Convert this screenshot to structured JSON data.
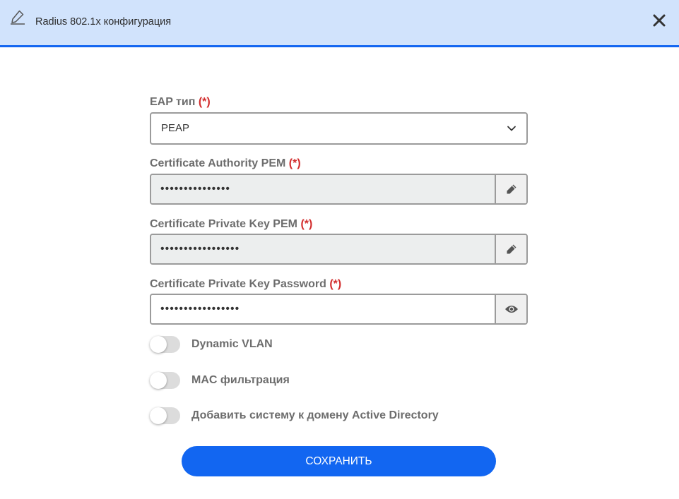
{
  "header": {
    "title": "Radius 802.1x конфигурация",
    "icon": "pencil-icon",
    "close_icon": "close-icon",
    "background": "#d1e3fc",
    "accent": "#1266f1"
  },
  "form": {
    "required_marker": "(*)",
    "eap_type": {
      "label": "EAP тип",
      "value": "PEAP"
    },
    "ca_pem": {
      "label": "Certificate Authority PEM",
      "value": "•••••••••••••••",
      "action_icon": "pencil-icon"
    },
    "private_key_pem": {
      "label": "Certificate Private Key PEM",
      "value": "•••••••••••••••••",
      "action_icon": "pencil-icon"
    },
    "private_key_password": {
      "label": "Certificate Private Key Password",
      "value": "•••••••••••••••••",
      "action_icon": "eye-icon"
    },
    "toggles": [
      {
        "label": "Dynamic VLAN",
        "on": false
      },
      {
        "label": "MAC фильтрация",
        "on": false
      },
      {
        "label": "Добавить систему к домену Active Directory",
        "on": false
      }
    ],
    "save_label": "СОХРАНИТЬ"
  }
}
